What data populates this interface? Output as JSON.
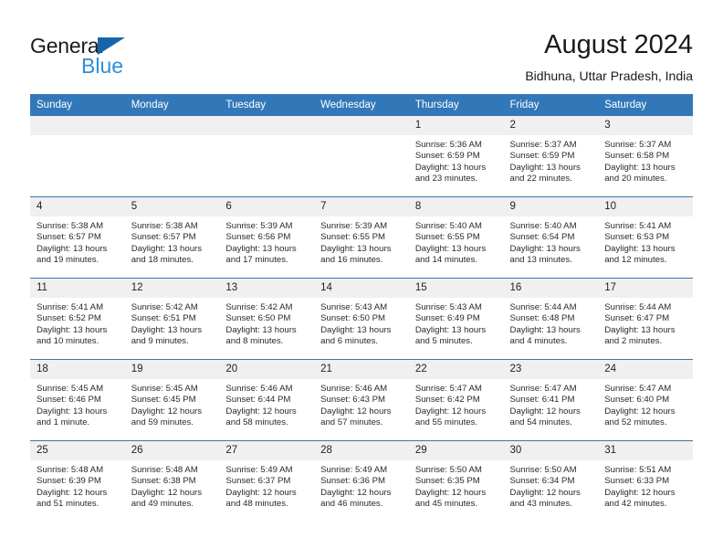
{
  "brand": {
    "name_part1": "General",
    "name_part2": "Blue",
    "accent_color": "#2f8fd8",
    "triangle_color": "#1565a8"
  },
  "header": {
    "title": "August 2024",
    "subtitle": "Bidhuna, Uttar Pradesh, India",
    "header_bar_color": "#3278b9",
    "daynum_background": "#f0f0f0"
  },
  "weekday_headers": [
    "Sunday",
    "Monday",
    "Tuesday",
    "Wednesday",
    "Thursday",
    "Friday",
    "Saturday"
  ],
  "weeks": [
    [
      {
        "day": "",
        "lines": []
      },
      {
        "day": "",
        "lines": []
      },
      {
        "day": "",
        "lines": []
      },
      {
        "day": "",
        "lines": []
      },
      {
        "day": "1",
        "lines": [
          "Sunrise: 5:36 AM",
          "Sunset: 6:59 PM",
          "Daylight: 13 hours",
          "and 23 minutes."
        ]
      },
      {
        "day": "2",
        "lines": [
          "Sunrise: 5:37 AM",
          "Sunset: 6:59 PM",
          "Daylight: 13 hours",
          "and 22 minutes."
        ]
      },
      {
        "day": "3",
        "lines": [
          "Sunrise: 5:37 AM",
          "Sunset: 6:58 PM",
          "Daylight: 13 hours",
          "and 20 minutes."
        ]
      }
    ],
    [
      {
        "day": "4",
        "lines": [
          "Sunrise: 5:38 AM",
          "Sunset: 6:57 PM",
          "Daylight: 13 hours",
          "and 19 minutes."
        ]
      },
      {
        "day": "5",
        "lines": [
          "Sunrise: 5:38 AM",
          "Sunset: 6:57 PM",
          "Daylight: 13 hours",
          "and 18 minutes."
        ]
      },
      {
        "day": "6",
        "lines": [
          "Sunrise: 5:39 AM",
          "Sunset: 6:56 PM",
          "Daylight: 13 hours",
          "and 17 minutes."
        ]
      },
      {
        "day": "7",
        "lines": [
          "Sunrise: 5:39 AM",
          "Sunset: 6:55 PM",
          "Daylight: 13 hours",
          "and 16 minutes."
        ]
      },
      {
        "day": "8",
        "lines": [
          "Sunrise: 5:40 AM",
          "Sunset: 6:55 PM",
          "Daylight: 13 hours",
          "and 14 minutes."
        ]
      },
      {
        "day": "9",
        "lines": [
          "Sunrise: 5:40 AM",
          "Sunset: 6:54 PM",
          "Daylight: 13 hours",
          "and 13 minutes."
        ]
      },
      {
        "day": "10",
        "lines": [
          "Sunrise: 5:41 AM",
          "Sunset: 6:53 PM",
          "Daylight: 13 hours",
          "and 12 minutes."
        ]
      }
    ],
    [
      {
        "day": "11",
        "lines": [
          "Sunrise: 5:41 AM",
          "Sunset: 6:52 PM",
          "Daylight: 13 hours",
          "and 10 minutes."
        ]
      },
      {
        "day": "12",
        "lines": [
          "Sunrise: 5:42 AM",
          "Sunset: 6:51 PM",
          "Daylight: 13 hours",
          "and 9 minutes."
        ]
      },
      {
        "day": "13",
        "lines": [
          "Sunrise: 5:42 AM",
          "Sunset: 6:50 PM",
          "Daylight: 13 hours",
          "and 8 minutes."
        ]
      },
      {
        "day": "14",
        "lines": [
          "Sunrise: 5:43 AM",
          "Sunset: 6:50 PM",
          "Daylight: 13 hours",
          "and 6 minutes."
        ]
      },
      {
        "day": "15",
        "lines": [
          "Sunrise: 5:43 AM",
          "Sunset: 6:49 PM",
          "Daylight: 13 hours",
          "and 5 minutes."
        ]
      },
      {
        "day": "16",
        "lines": [
          "Sunrise: 5:44 AM",
          "Sunset: 6:48 PM",
          "Daylight: 13 hours",
          "and 4 minutes."
        ]
      },
      {
        "day": "17",
        "lines": [
          "Sunrise: 5:44 AM",
          "Sunset: 6:47 PM",
          "Daylight: 13 hours",
          "and 2 minutes."
        ]
      }
    ],
    [
      {
        "day": "18",
        "lines": [
          "Sunrise: 5:45 AM",
          "Sunset: 6:46 PM",
          "Daylight: 13 hours",
          "and 1 minute."
        ]
      },
      {
        "day": "19",
        "lines": [
          "Sunrise: 5:45 AM",
          "Sunset: 6:45 PM",
          "Daylight: 12 hours",
          "and 59 minutes."
        ]
      },
      {
        "day": "20",
        "lines": [
          "Sunrise: 5:46 AM",
          "Sunset: 6:44 PM",
          "Daylight: 12 hours",
          "and 58 minutes."
        ]
      },
      {
        "day": "21",
        "lines": [
          "Sunrise: 5:46 AM",
          "Sunset: 6:43 PM",
          "Daylight: 12 hours",
          "and 57 minutes."
        ]
      },
      {
        "day": "22",
        "lines": [
          "Sunrise: 5:47 AM",
          "Sunset: 6:42 PM",
          "Daylight: 12 hours",
          "and 55 minutes."
        ]
      },
      {
        "day": "23",
        "lines": [
          "Sunrise: 5:47 AM",
          "Sunset: 6:41 PM",
          "Daylight: 12 hours",
          "and 54 minutes."
        ]
      },
      {
        "day": "24",
        "lines": [
          "Sunrise: 5:47 AM",
          "Sunset: 6:40 PM",
          "Daylight: 12 hours",
          "and 52 minutes."
        ]
      }
    ],
    [
      {
        "day": "25",
        "lines": [
          "Sunrise: 5:48 AM",
          "Sunset: 6:39 PM",
          "Daylight: 12 hours",
          "and 51 minutes."
        ]
      },
      {
        "day": "26",
        "lines": [
          "Sunrise: 5:48 AM",
          "Sunset: 6:38 PM",
          "Daylight: 12 hours",
          "and 49 minutes."
        ]
      },
      {
        "day": "27",
        "lines": [
          "Sunrise: 5:49 AM",
          "Sunset: 6:37 PM",
          "Daylight: 12 hours",
          "and 48 minutes."
        ]
      },
      {
        "day": "28",
        "lines": [
          "Sunrise: 5:49 AM",
          "Sunset: 6:36 PM",
          "Daylight: 12 hours",
          "and 46 minutes."
        ]
      },
      {
        "day": "29",
        "lines": [
          "Sunrise: 5:50 AM",
          "Sunset: 6:35 PM",
          "Daylight: 12 hours",
          "and 45 minutes."
        ]
      },
      {
        "day": "30",
        "lines": [
          "Sunrise: 5:50 AM",
          "Sunset: 6:34 PM",
          "Daylight: 12 hours",
          "and 43 minutes."
        ]
      },
      {
        "day": "31",
        "lines": [
          "Sunrise: 5:51 AM",
          "Sunset: 6:33 PM",
          "Daylight: 12 hours",
          "and 42 minutes."
        ]
      }
    ]
  ]
}
